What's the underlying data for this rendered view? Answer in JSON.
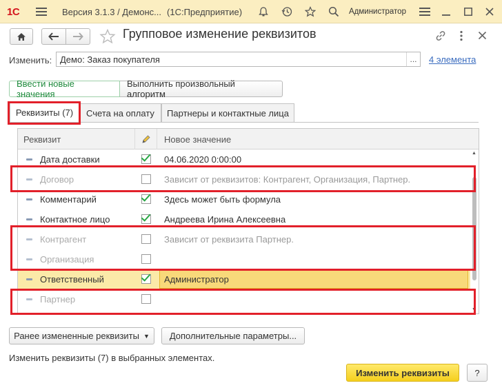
{
  "titlebar": {
    "logo": "1С",
    "version": "Версия 3.1.3 / Демонс...",
    "product": "(1С:Предприятие)",
    "user": "Администратор"
  },
  "header": {
    "title": "Групповое изменение реквизитов"
  },
  "filter": {
    "label": "Изменить:",
    "value": "Демо: Заказ покупателя",
    "select_label": "...",
    "count_link": "4 элемента"
  },
  "mode_buttons": {
    "enter_values": "Ввести новые значения",
    "algorithm": "Выполнить произвольный алгоритм"
  },
  "tabs": [
    {
      "label": "Реквизиты (7)"
    },
    {
      "label": "Счета на оплату"
    },
    {
      "label": "Партнеры и контактные лица"
    }
  ],
  "grid": {
    "headers": {
      "attribute": "Реквизит",
      "value": "Новое значение"
    },
    "rows": [
      {
        "name": "Дата доставки",
        "checked": true,
        "value": "04.06.2020 0:00:00"
      },
      {
        "name": "Договор",
        "checked": false,
        "value": "Зависит от реквизитов: Контрагент, Организация, Партнер."
      },
      {
        "name": "Комментарий",
        "checked": true,
        "value": "Здесь может быть формула"
      },
      {
        "name": "Контактное лицо",
        "checked": true,
        "value": "Андреева Ирина Алексеевна"
      },
      {
        "name": "Контрагент",
        "checked": false,
        "value": "Зависит от реквизита Партнер."
      },
      {
        "name": "Организация",
        "checked": false,
        "value": ""
      },
      {
        "name": "Ответственный",
        "checked": true,
        "value": "Администратор"
      },
      {
        "name": "Партнер",
        "checked": false,
        "value": ""
      }
    ]
  },
  "footer_buttons": {
    "previous": "Ранее измененные реквизиты",
    "extra": "Дополнительные параметры..."
  },
  "status_text": "Изменить реквизиты (7) в выбранных элементах.",
  "actions": {
    "apply": "Изменить реквизиты",
    "help": "?"
  },
  "colors": {
    "titlebar_bg": "#fbeec1",
    "accent_yellow": "#f5cf1d",
    "highlight_frame": "#e2202a",
    "check_green": "#2aa846",
    "link_blue": "#3a6cbf"
  }
}
